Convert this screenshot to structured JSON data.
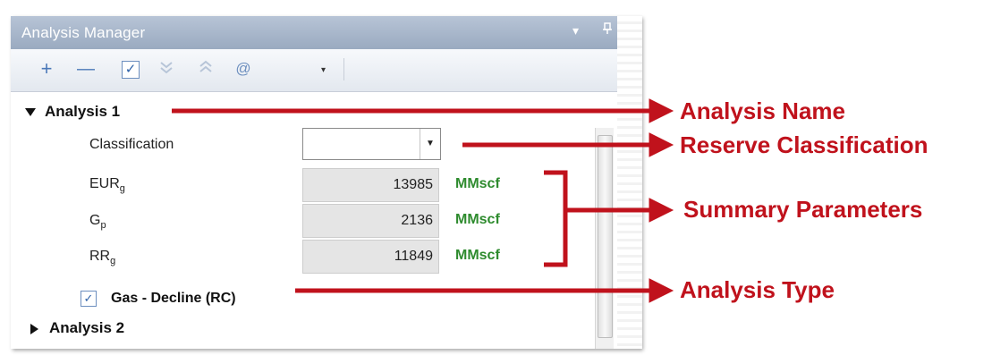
{
  "window": {
    "title": "Analysis Manager",
    "dropdown_icon": "▾",
    "pin_icon": "ᵖ"
  },
  "toolbar": {
    "add_icon": "+",
    "remove_icon": "—",
    "check_icon": "✓",
    "expand_all_icon": "double-chevron-down-icon",
    "collapse_all_icon": "double-chevron-up-icon",
    "at_icon": "@",
    "menu_dropdown_icon": "▾"
  },
  "tree": {
    "analysis1": {
      "name": "Analysis 1",
      "classification_label": "Classification",
      "classification_value": "",
      "params": [
        {
          "label": "EUR",
          "sub": "g",
          "value": "13985",
          "unit": "MMscf"
        },
        {
          "label": "G",
          "sub": "p",
          "value": "2136",
          "unit": "MMscf"
        },
        {
          "label": "RR",
          "sub": "g",
          "value": "11849",
          "unit": "MMscf"
        }
      ],
      "type_checked": true,
      "type_label": "Gas - Decline (RC)"
    },
    "analysis2": {
      "name": "Analysis 2"
    }
  },
  "annotations": {
    "name": "Analysis Name",
    "classification": "Reserve Classification",
    "summary": "Summary Parameters",
    "type": "Analysis Type"
  },
  "colors": {
    "annotation": "#c0121c",
    "unit": "#2e8b2e",
    "titlebar": "#a9b7cb"
  }
}
